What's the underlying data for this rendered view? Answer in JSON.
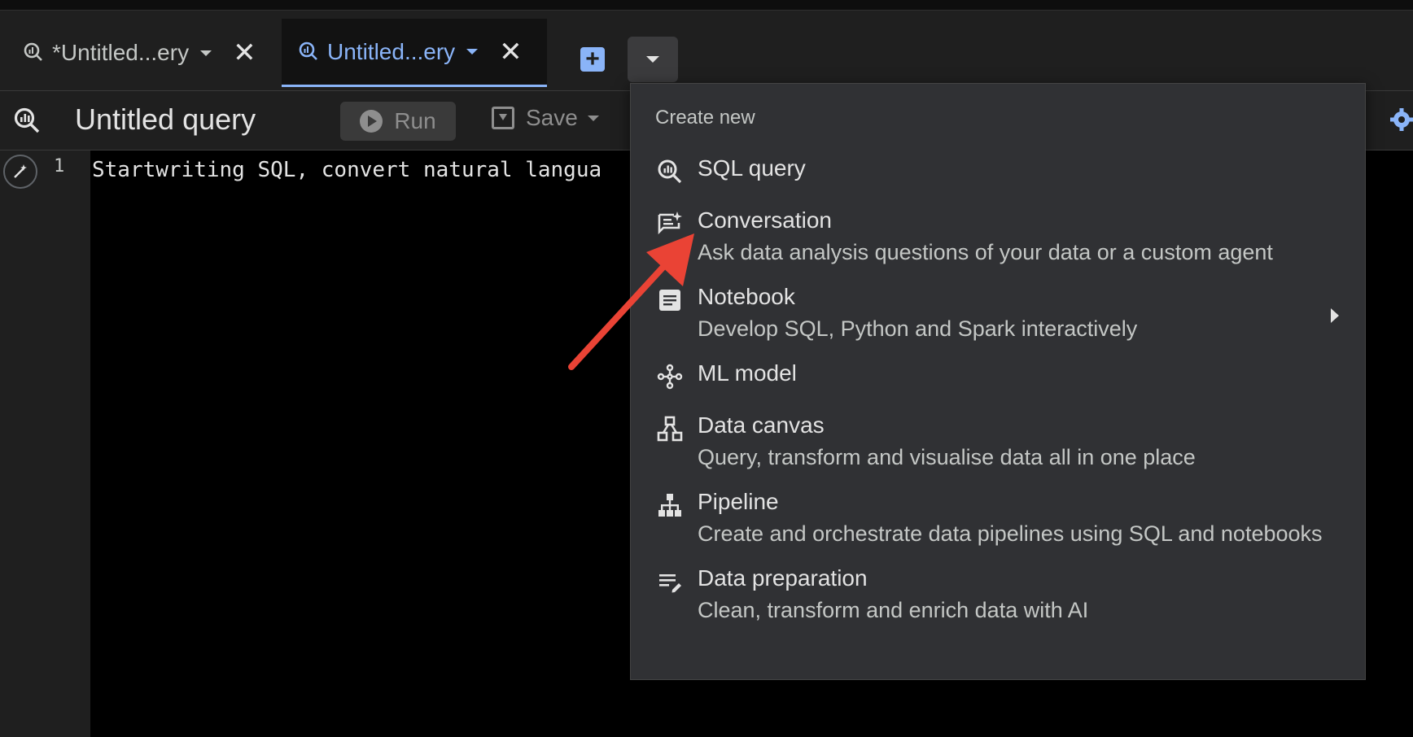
{
  "tabs": [
    {
      "label": "*Untitled...ery",
      "active": false
    },
    {
      "label": "Untitled...ery",
      "active": true
    }
  ],
  "toolbar": {
    "query_title": "Untitled query",
    "run_label": "Run",
    "save_label": "Save"
  },
  "editor": {
    "line_number": "1",
    "placeholder_text": "Startwriting SQL, convert natural langua"
  },
  "menu": {
    "header": "Create new",
    "items": [
      {
        "title": "SQL query",
        "description": "",
        "icon": "sql-query-icon"
      },
      {
        "title": "Conversation",
        "description": "Ask data analysis questions of your data or a custom agent",
        "icon": "conversation-icon"
      },
      {
        "title": "Notebook",
        "description": "Develop SQL, Python and Spark interactively",
        "icon": "notebook-icon",
        "has_submenu": true
      },
      {
        "title": "ML model",
        "description": "",
        "icon": "ml-model-icon"
      },
      {
        "title": "Data canvas",
        "description": "Query, transform and visualise data all in one place",
        "icon": "data-canvas-icon"
      },
      {
        "title": "Pipeline",
        "description": "Create and orchestrate data pipelines using SQL and notebooks",
        "icon": "pipeline-icon"
      },
      {
        "title": "Data preparation",
        "description": "Clean, transform and enrich data with AI",
        "icon": "data-preparation-icon"
      }
    ]
  },
  "colors": {
    "accent": "#8ab4f8",
    "annotation_arrow": "#ea4335",
    "menu_bg": "#303134",
    "editor_bg": "#000000"
  }
}
